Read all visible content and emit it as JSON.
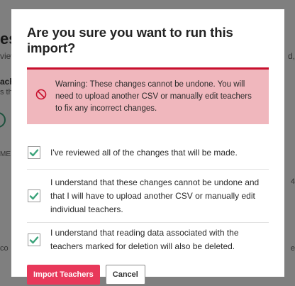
{
  "background": {
    "title_fragment": "es",
    "subtitle_fragment": "view",
    "bold_fragment": "ach",
    "small_fragment": "s th",
    "column_fragment": "ME",
    "right_fragment_1": "d,",
    "right_fragment_2": "4",
    "left_fragment_3": "co",
    "right_fragment_3": "e"
  },
  "modal": {
    "title": "Are you sure you want to run this import?",
    "warning": {
      "icon": "prohibited-icon",
      "text": "Warning: These changes cannot be undone. You will need to upload another CSV or manually edit teachers to fix any incorrect changes."
    },
    "checkboxes": [
      {
        "label": "I've reviewed all of the changes that will be made.",
        "checked": true
      },
      {
        "label": "I understand that these changes cannot be undone and that I will have to upload another CSV or manually edit individual teachers.",
        "checked": true
      },
      {
        "label": "I understand that reading data associated with the teachers marked for deletion will also be deleted.",
        "checked": true
      }
    ],
    "primary_button": "Import Teachers",
    "secondary_button": "Cancel"
  },
  "colors": {
    "accent": "#e8385a",
    "warning_bg": "#f0b7bd",
    "warning_border": "#c8102e",
    "check": "#3aa37a"
  }
}
